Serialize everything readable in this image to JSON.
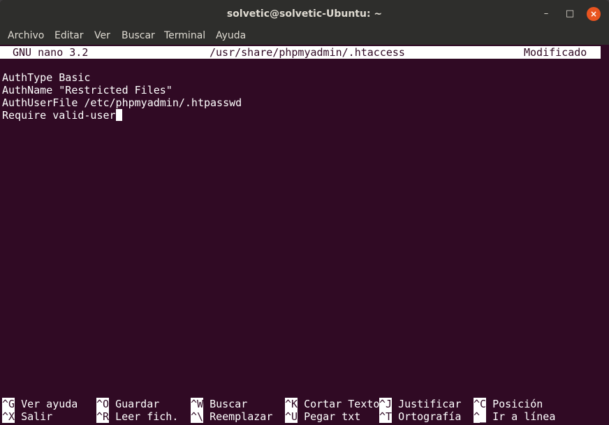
{
  "window": {
    "title": "solvetic@solvetic-Ubuntu: ~",
    "minimize_glyph": "–",
    "maximize_glyph": "□",
    "close_glyph": "×"
  },
  "menu": [
    "Archivo",
    "Editar",
    "Ver",
    "Buscar",
    "Terminal",
    "Ayuda"
  ],
  "nano": {
    "version": "GNU nano 3.2",
    "file": "/usr/share/phpmyadmin/.htaccess",
    "state": "Modificado"
  },
  "content_lines": [
    "AuthType Basic",
    "AuthName \"Restricted Files\"",
    "AuthUserFile /etc/phpmyadmin/.htpasswd",
    "Require valid-user"
  ],
  "shortcuts": [
    {
      "key": "^G",
      "label": "Ver ayuda"
    },
    {
      "key": "^O",
      "label": "Guardar"
    },
    {
      "key": "^W",
      "label": "Buscar"
    },
    {
      "key": "^K",
      "label": "Cortar Texto"
    },
    {
      "key": "^J",
      "label": "Justificar"
    },
    {
      "key": "^C",
      "label": "Posición"
    },
    {
      "key": "^X",
      "label": "Salir"
    },
    {
      "key": "^R",
      "label": "Leer fich."
    },
    {
      "key": "^\\",
      "label": "Reemplazar"
    },
    {
      "key": "^U",
      "label": "Pegar txt"
    },
    {
      "key": "^T",
      "label": "Ortografía"
    },
    {
      "key": "^_",
      "label": "Ir a línea"
    }
  ],
  "colors": {
    "terminal_bg": "#300a24",
    "titlebar_bg": "#2e2e2c",
    "close_button": "#e95420",
    "text": "#ffffff"
  }
}
